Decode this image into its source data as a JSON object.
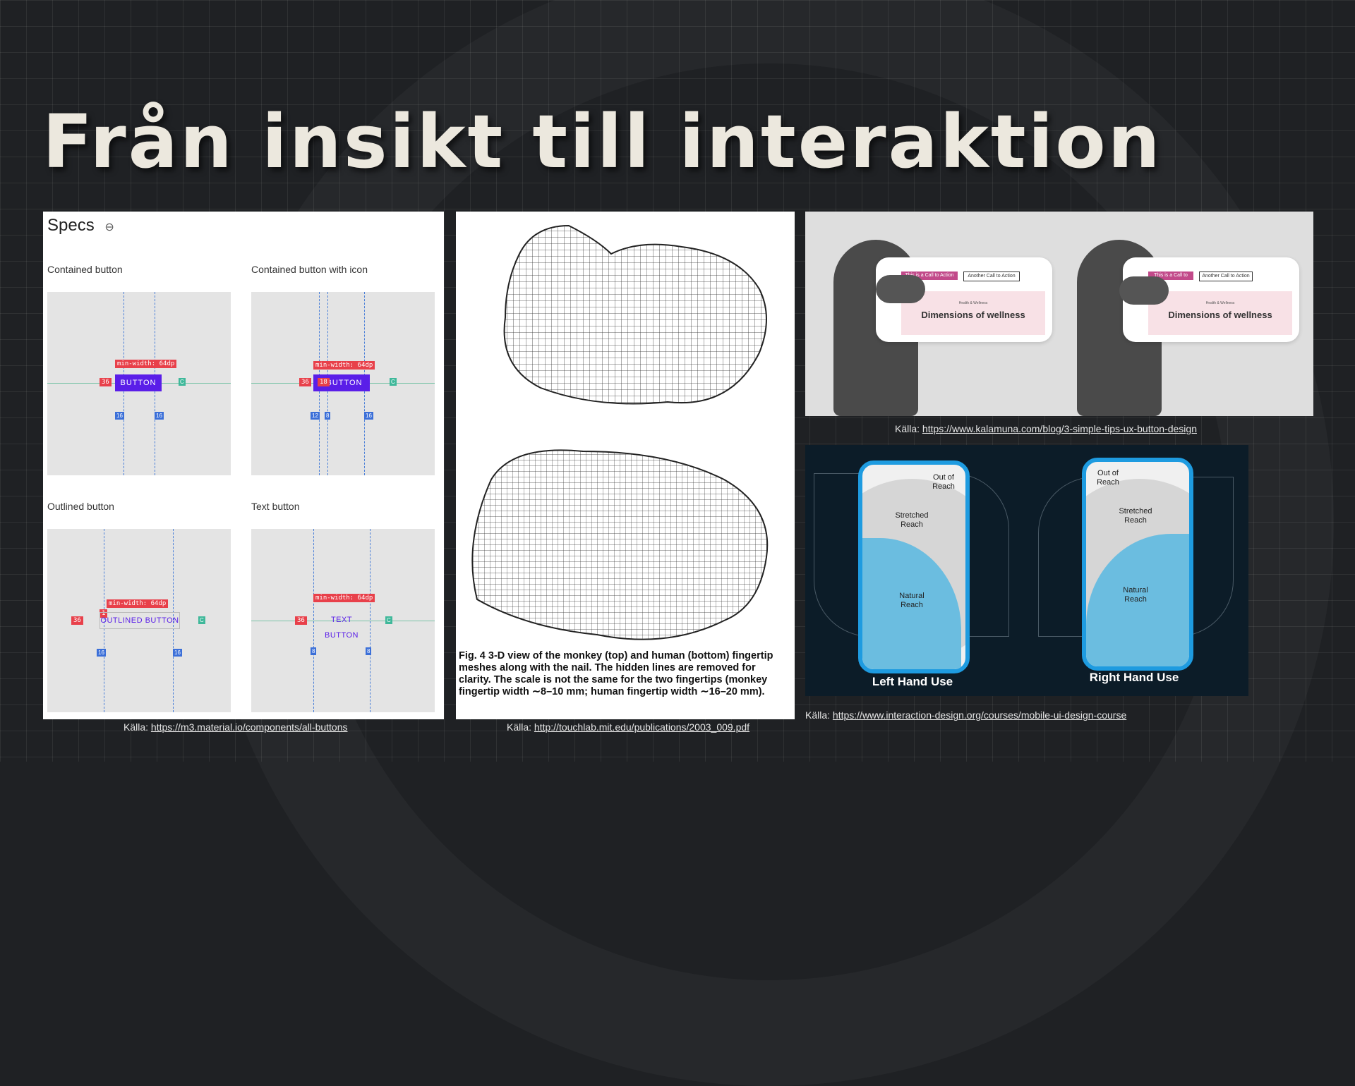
{
  "slide": {
    "title": "Från insikt till interaktion"
  },
  "specs_panel": {
    "heading": "Specs",
    "link_icon": "link-icon",
    "sections": [
      {
        "label": "Contained button",
        "button_label": "BUTTON",
        "min_width": "min-width: 64dp",
        "left_pad": "36",
        "spacing": [
          "16",
          "16"
        ],
        "end_tag": "C"
      },
      {
        "label": "Contained button with icon",
        "button_label": "BUTTON",
        "min_width": "min-width: 64dp",
        "left_pad": "36",
        "icon_tag": "18",
        "spacing": [
          "12",
          "8",
          "16"
        ],
        "end_tag": "C"
      },
      {
        "label": "Outlined button",
        "button_label": "OUTLINED BUTTON",
        "min_width": "min-width: 64dp",
        "left_pad": "36",
        "corner_tag": "1",
        "spacing": [
          "16",
          "16"
        ],
        "end_tag": "C"
      },
      {
        "label": "Text button",
        "button_label": "TEXT BUTTON",
        "min_width": "min-width: 64dp",
        "left_pad": "36",
        "spacing": [
          "8",
          "8"
        ],
        "end_tag": "C"
      }
    ],
    "caption_prefix": "Källa: ",
    "caption_url": "https://m3.material.io/components/all-buttons"
  },
  "figure_panel": {
    "caption": "Fig. 4   3-D view of the monkey (top) and human (bottom) fingertip meshes along with the nail. The hidden lines are removed for clarity. The scale is not the same for the two fingertips (monkey fingertip width ∼8–10 mm; human fingertip width ∼16–20 mm).",
    "caption_prefix": "Källa: ",
    "caption_url": "http://touchlab.mit.edu/publications/2003_009.pdf"
  },
  "photo_panel": {
    "phones": [
      {
        "primary_button": "This is a Call to Action",
        "secondary_button": "Another Call to Action",
        "eyebrow": "Health & Wellness",
        "heading": "Dimensions of wellness"
      },
      {
        "primary_button": "This is a Call to Action",
        "secondary_button": "Another Call to Action",
        "eyebrow": "Health & Wellness",
        "heading": "Dimensions of wellness"
      }
    ],
    "caption_prefix": "Källa: ",
    "caption_url": "https://www.kalamuna.com/blog/3-simple-tips-ux-button-design"
  },
  "reach_panel": {
    "left": {
      "out": "Out of\nReach",
      "stretched": "Stretched\nReach",
      "natural": "Natural\nReach",
      "label": "Left Hand Use"
    },
    "right": {
      "out": "Out of\nReach",
      "stretched": "Stretched\nReach",
      "natural": "Natural\nReach",
      "label": "Right Hand Use"
    },
    "colors": {
      "natural": "#6bbde0",
      "stretched": "#d6d6d6",
      "frame": "#1e9be0",
      "background": "#0c1c28"
    },
    "caption_prefix": "Källa: ",
    "caption_url": "https://www.interaction-design.org/courses/mobile-ui-design-course"
  }
}
